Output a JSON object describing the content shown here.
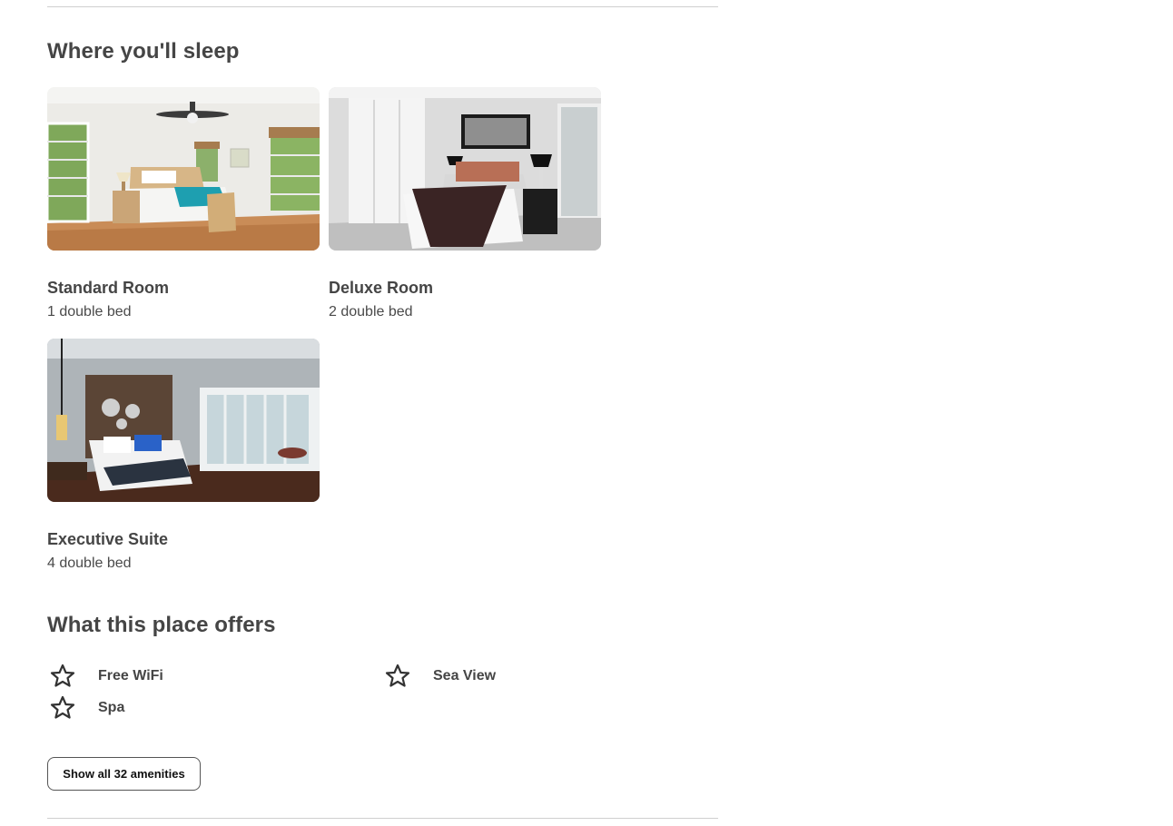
{
  "sleep": {
    "title": "Where you'll sleep",
    "rooms": [
      {
        "name": "Standard Room",
        "beds": "1 double bed"
      },
      {
        "name": "Deluxe Room",
        "beds": "2 double bed"
      },
      {
        "name": "Executive Suite",
        "beds": "4 double bed"
      }
    ]
  },
  "offers": {
    "title": "What this place offers",
    "amenities": [
      {
        "label": "Free WiFi",
        "icon": "star-icon"
      },
      {
        "label": "Sea View",
        "icon": "star-icon"
      },
      {
        "label": "Spa",
        "icon": "star-icon"
      }
    ],
    "show_all_label": "Show all 32 amenities"
  }
}
